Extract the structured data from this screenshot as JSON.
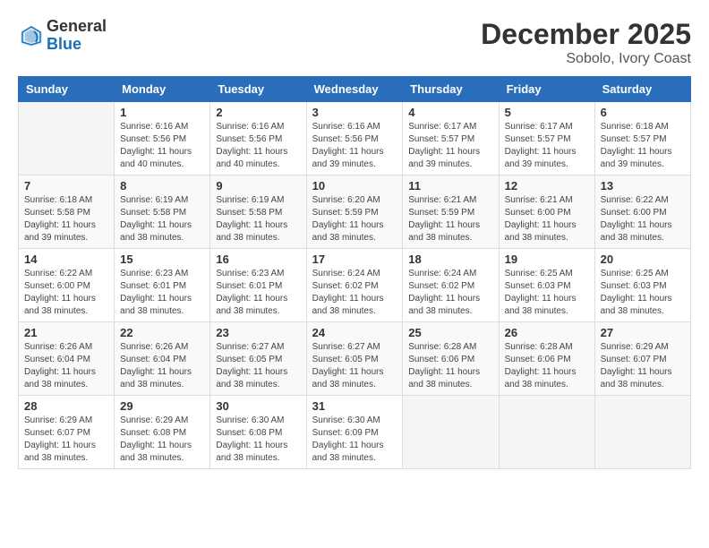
{
  "header": {
    "logo": {
      "general": "General",
      "blue": "Blue"
    },
    "month": "December 2025",
    "location": "Sobolo, Ivory Coast"
  },
  "days_of_week": [
    "Sunday",
    "Monday",
    "Tuesday",
    "Wednesday",
    "Thursday",
    "Friday",
    "Saturday"
  ],
  "weeks": [
    [
      {
        "day": "",
        "info": ""
      },
      {
        "day": "1",
        "info": "Sunrise: 6:16 AM\nSunset: 5:56 PM\nDaylight: 11 hours\nand 40 minutes."
      },
      {
        "day": "2",
        "info": "Sunrise: 6:16 AM\nSunset: 5:56 PM\nDaylight: 11 hours\nand 40 minutes."
      },
      {
        "day": "3",
        "info": "Sunrise: 6:16 AM\nSunset: 5:56 PM\nDaylight: 11 hours\nand 39 minutes."
      },
      {
        "day": "4",
        "info": "Sunrise: 6:17 AM\nSunset: 5:57 PM\nDaylight: 11 hours\nand 39 minutes."
      },
      {
        "day": "5",
        "info": "Sunrise: 6:17 AM\nSunset: 5:57 PM\nDaylight: 11 hours\nand 39 minutes."
      },
      {
        "day": "6",
        "info": "Sunrise: 6:18 AM\nSunset: 5:57 PM\nDaylight: 11 hours\nand 39 minutes."
      }
    ],
    [
      {
        "day": "7",
        "info": "Sunrise: 6:18 AM\nSunset: 5:58 PM\nDaylight: 11 hours\nand 39 minutes."
      },
      {
        "day": "8",
        "info": "Sunrise: 6:19 AM\nSunset: 5:58 PM\nDaylight: 11 hours\nand 38 minutes."
      },
      {
        "day": "9",
        "info": "Sunrise: 6:19 AM\nSunset: 5:58 PM\nDaylight: 11 hours\nand 38 minutes."
      },
      {
        "day": "10",
        "info": "Sunrise: 6:20 AM\nSunset: 5:59 PM\nDaylight: 11 hours\nand 38 minutes."
      },
      {
        "day": "11",
        "info": "Sunrise: 6:21 AM\nSunset: 5:59 PM\nDaylight: 11 hours\nand 38 minutes."
      },
      {
        "day": "12",
        "info": "Sunrise: 6:21 AM\nSunset: 6:00 PM\nDaylight: 11 hours\nand 38 minutes."
      },
      {
        "day": "13",
        "info": "Sunrise: 6:22 AM\nSunset: 6:00 PM\nDaylight: 11 hours\nand 38 minutes."
      }
    ],
    [
      {
        "day": "14",
        "info": "Sunrise: 6:22 AM\nSunset: 6:00 PM\nDaylight: 11 hours\nand 38 minutes."
      },
      {
        "day": "15",
        "info": "Sunrise: 6:23 AM\nSunset: 6:01 PM\nDaylight: 11 hours\nand 38 minutes."
      },
      {
        "day": "16",
        "info": "Sunrise: 6:23 AM\nSunset: 6:01 PM\nDaylight: 11 hours\nand 38 minutes."
      },
      {
        "day": "17",
        "info": "Sunrise: 6:24 AM\nSunset: 6:02 PM\nDaylight: 11 hours\nand 38 minutes."
      },
      {
        "day": "18",
        "info": "Sunrise: 6:24 AM\nSunset: 6:02 PM\nDaylight: 11 hours\nand 38 minutes."
      },
      {
        "day": "19",
        "info": "Sunrise: 6:25 AM\nSunset: 6:03 PM\nDaylight: 11 hours\nand 38 minutes."
      },
      {
        "day": "20",
        "info": "Sunrise: 6:25 AM\nSunset: 6:03 PM\nDaylight: 11 hours\nand 38 minutes."
      }
    ],
    [
      {
        "day": "21",
        "info": "Sunrise: 6:26 AM\nSunset: 6:04 PM\nDaylight: 11 hours\nand 38 minutes."
      },
      {
        "day": "22",
        "info": "Sunrise: 6:26 AM\nSunset: 6:04 PM\nDaylight: 11 hours\nand 38 minutes."
      },
      {
        "day": "23",
        "info": "Sunrise: 6:27 AM\nSunset: 6:05 PM\nDaylight: 11 hours\nand 38 minutes."
      },
      {
        "day": "24",
        "info": "Sunrise: 6:27 AM\nSunset: 6:05 PM\nDaylight: 11 hours\nand 38 minutes."
      },
      {
        "day": "25",
        "info": "Sunrise: 6:28 AM\nSunset: 6:06 PM\nDaylight: 11 hours\nand 38 minutes."
      },
      {
        "day": "26",
        "info": "Sunrise: 6:28 AM\nSunset: 6:06 PM\nDaylight: 11 hours\nand 38 minutes."
      },
      {
        "day": "27",
        "info": "Sunrise: 6:29 AM\nSunset: 6:07 PM\nDaylight: 11 hours\nand 38 minutes."
      }
    ],
    [
      {
        "day": "28",
        "info": "Sunrise: 6:29 AM\nSunset: 6:07 PM\nDaylight: 11 hours\nand 38 minutes."
      },
      {
        "day": "29",
        "info": "Sunrise: 6:29 AM\nSunset: 6:08 PM\nDaylight: 11 hours\nand 38 minutes."
      },
      {
        "day": "30",
        "info": "Sunrise: 6:30 AM\nSunset: 6:08 PM\nDaylight: 11 hours\nand 38 minutes."
      },
      {
        "day": "31",
        "info": "Sunrise: 6:30 AM\nSunset: 6:09 PM\nDaylight: 11 hours\nand 38 minutes."
      },
      {
        "day": "",
        "info": ""
      },
      {
        "day": "",
        "info": ""
      },
      {
        "day": "",
        "info": ""
      }
    ]
  ]
}
